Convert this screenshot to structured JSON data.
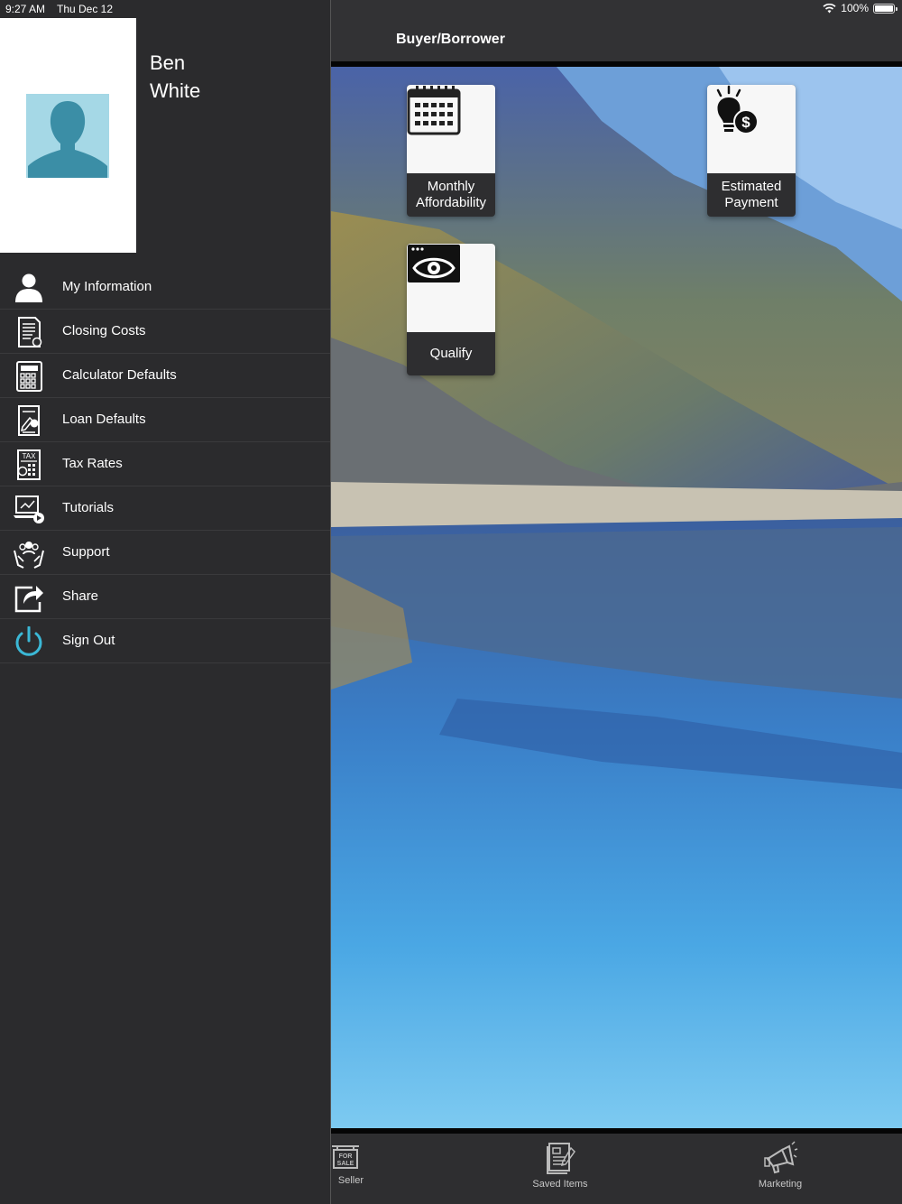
{
  "status_bar": {
    "time": "9:27 AM",
    "date": "Thu Dec 12",
    "battery": "100%"
  },
  "header": {
    "title": "Buyer/Borrower"
  },
  "user": {
    "first_name": "Ben",
    "last_name": "White"
  },
  "menu": {
    "items": [
      {
        "label": "My Information",
        "icon": "user-icon"
      },
      {
        "label": "Closing Costs",
        "icon": "document-icon"
      },
      {
        "label": "Calculator Defaults",
        "icon": "calculator-icon"
      },
      {
        "label": "Loan Defaults",
        "icon": "loan-document-icon"
      },
      {
        "label": "Tax Rates",
        "icon": "tax-icon"
      },
      {
        "label": "Tutorials",
        "icon": "video-tutorial-icon"
      },
      {
        "label": "Support",
        "icon": "support-icon"
      },
      {
        "label": "Share",
        "icon": "share-icon"
      },
      {
        "label": "Sign Out",
        "icon": "power-icon"
      }
    ]
  },
  "tiles": {
    "monthly": {
      "line1": "Monthly",
      "line2": "Affordability",
      "icon": "calendar-icon"
    },
    "estimated": {
      "line1": "Estimated",
      "line2": "Payment",
      "icon": "lightbulb-dollar-icon"
    },
    "qualify": {
      "label": "Qualify",
      "icon": "eye-icon"
    }
  },
  "tabs": {
    "seller": {
      "label": "Seller",
      "icon_text": "FOR SALE"
    },
    "saved": {
      "label": "Saved Items"
    },
    "marketing": {
      "label": "Marketing"
    }
  },
  "colors": {
    "accent": "#3bb8d6",
    "drawer_bg": "#2b2b2d",
    "avatar_bg": "#a5d8e6"
  }
}
